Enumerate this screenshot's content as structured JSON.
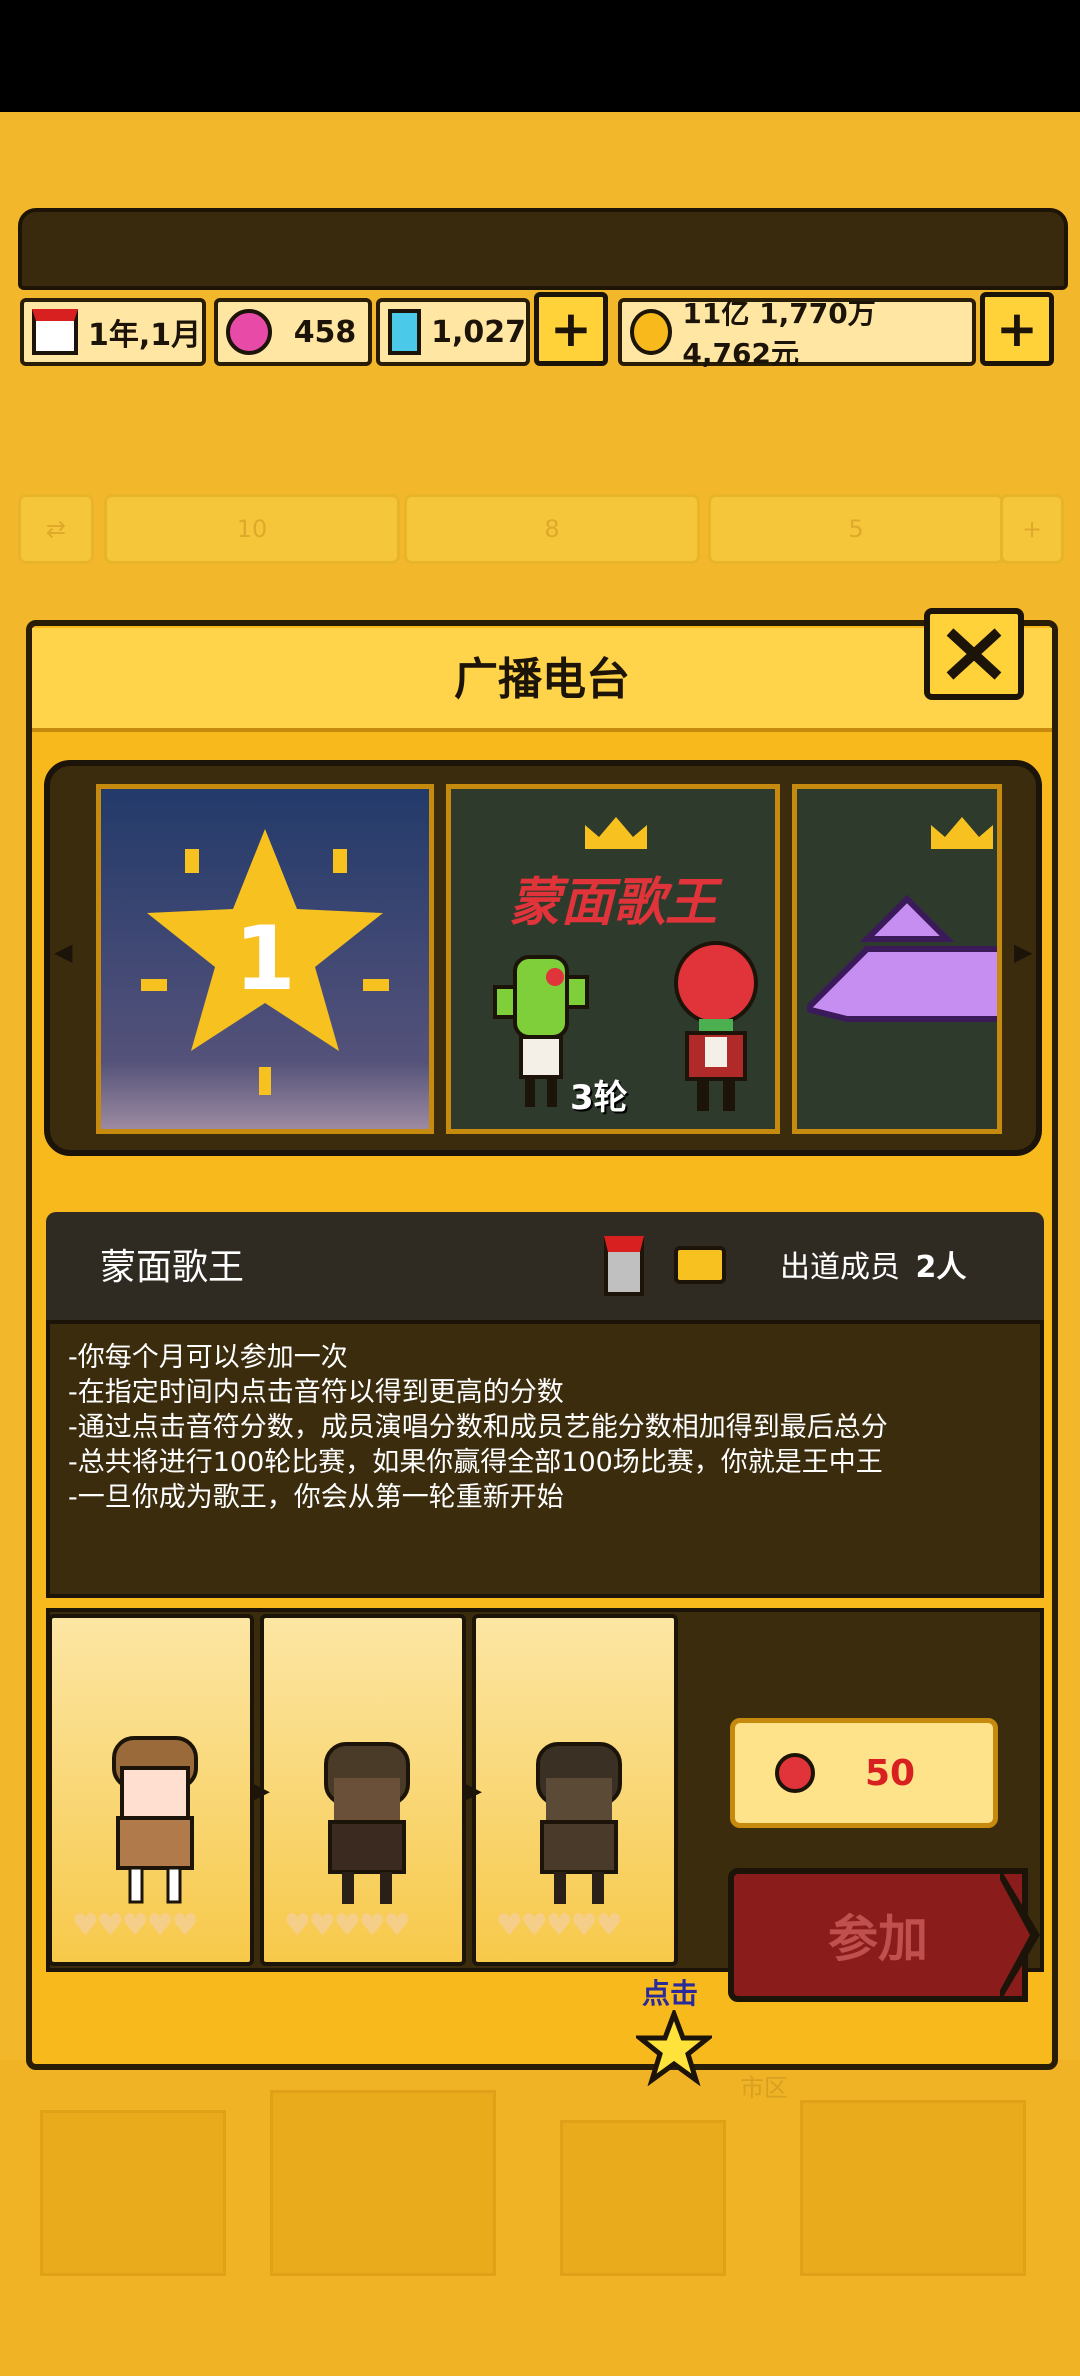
{
  "resources": {
    "date": "1年,1月",
    "gems": "458",
    "diamonds": "1,027",
    "money": "11亿 1,770万 4,762元"
  },
  "background_toolbar": {
    "value1": "10",
    "value2": "8",
    "value3": "5",
    "city_label": "市区"
  },
  "dialog": {
    "title": "广播电台",
    "cards": [
      {
        "badge": "1"
      },
      {
        "title": "蒙面歌王",
        "round": "3轮"
      },
      {
        "badge": ""
      }
    ],
    "event_name": "蒙面歌王",
    "members_label": "出道成员",
    "members_count": "2人",
    "rules": [
      "-你每个月可以参加一次",
      "-在指定时间内点击音符以得到更高的分数",
      "-通过点击音符分数，成员演唱分数和成员艺能分数相加得到最后总分",
      "-总共将进行100轮比赛，如果你赢得全部100场比赛，你就是王中王",
      "-一旦你成为歌王，你会从第一轮重新开始"
    ],
    "hearts": "♥♥♥♥♥",
    "cost": "50",
    "join_label": "参加",
    "tap_hint": "点击"
  },
  "colors": {
    "accent": "#f7b91c",
    "dark": "#3b2c0e",
    "join": "#8a1d1c"
  }
}
